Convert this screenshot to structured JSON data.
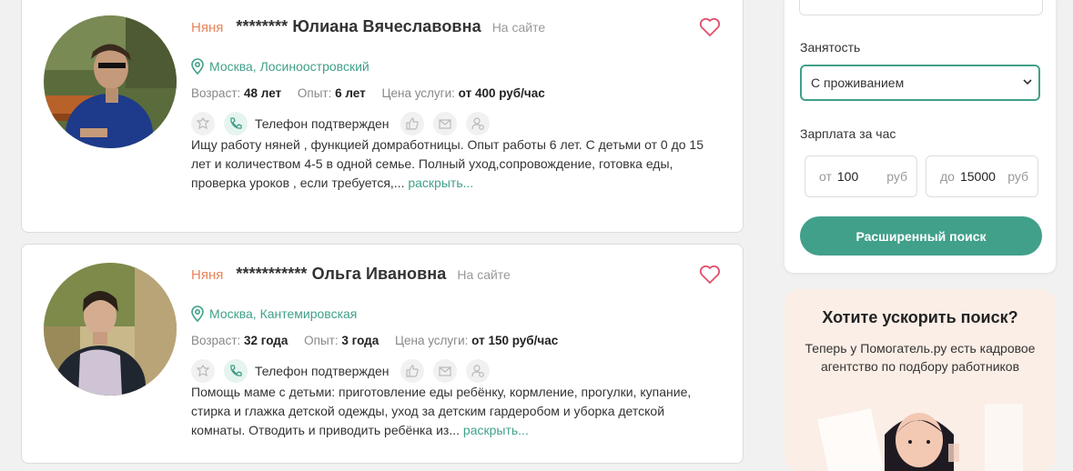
{
  "listings": [
    {
      "role": "Няня",
      "name": "******** Юлиана Вячеславовна",
      "online": "На сайте",
      "location": "Москва, Лосиноостровский",
      "age_label": "Возраст:",
      "age": "48 лет",
      "exp_label": "Опыт:",
      "exp": "6 лет",
      "price_label": "Цена услуги:",
      "price": "от 400 руб/час",
      "phone": "Телефон подтвержден",
      "description": "Ищу работу няней , функцией домработницы. Опыт работы 6 лет. С детьми от 0 до 15 лет и количеством 4-5 в одной семье. Полный уход,сопровождение, готовка еды, проверка уроков , если требуется,...",
      "more": "раскрыть..."
    },
    {
      "role": "Няня",
      "name": "*********** Ольга Ивановна",
      "online": "На сайте",
      "location": "Москва, Кантемировская",
      "age_label": "Возраст:",
      "age": "32 года",
      "exp_label": "Опыт:",
      "exp": "3 года",
      "price_label": "Цена услуги:",
      "price": "от 150 руб/час",
      "phone": "Телефон подтвержден",
      "description": "Помощь маме с детьми: приготовление еды ребёнку, кормление, прогулки, купание, стирка и глажка детской одежды, уход за детским гардеробом и уборка детской комнаты. Отводить и приводить ребёнка из...",
      "more": "раскрыть..."
    }
  ],
  "filter": {
    "employment_label": "Занятость",
    "employment_value": "С проживанием",
    "salary_label": "Зарплата за час",
    "from_prefix": "от",
    "from_value": "100",
    "to_prefix": "до",
    "to_value": "15000",
    "unit": "руб",
    "search_button": "Расширенный поиск"
  },
  "promo": {
    "title": "Хотите ускорить поиск?",
    "text": "Теперь у Помогатель.ру есть кадровое агентство по подбору работников"
  },
  "colors": {
    "accent": "#41a08a",
    "role": "#e8855a",
    "heart": "#e0506e"
  }
}
